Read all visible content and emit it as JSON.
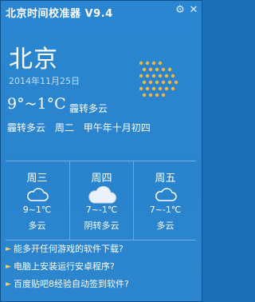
{
  "window": {
    "title": "北京时间校准器 V9.4"
  },
  "titlebar": {
    "settings_glyph": "⚙",
    "close_glyph": "✕"
  },
  "current": {
    "city": "北京",
    "date": "2014年11月25日",
    "temp": "9°~1°C",
    "weather": "霾转多云",
    "weather2": "霾转多云",
    "weekday": "周二",
    "lunar": "甲午年十月初四"
  },
  "forecast": [
    {
      "day": "周三",
      "temp": "9~1℃",
      "desc": "多云",
      "icon": "cloud-outline-icon"
    },
    {
      "day": "周四",
      "temp": "7~-1℃",
      "desc": "阴转多云",
      "icon": "cloud-filled-icon"
    },
    {
      "day": "周五",
      "temp": "7~-1℃",
      "desc": "多云",
      "icon": "cloud-outline-icon"
    }
  ],
  "links": [
    {
      "label": "能多开任何游戏的软件下载?"
    },
    {
      "label": "电脑上安装运行安卓程序?"
    },
    {
      "label": "百度贴吧8经验自动签到软件?"
    }
  ],
  "colors": {
    "background": "#2a86d0",
    "link_arrow": "#ffd24a",
    "dots": "#f0b73a"
  }
}
